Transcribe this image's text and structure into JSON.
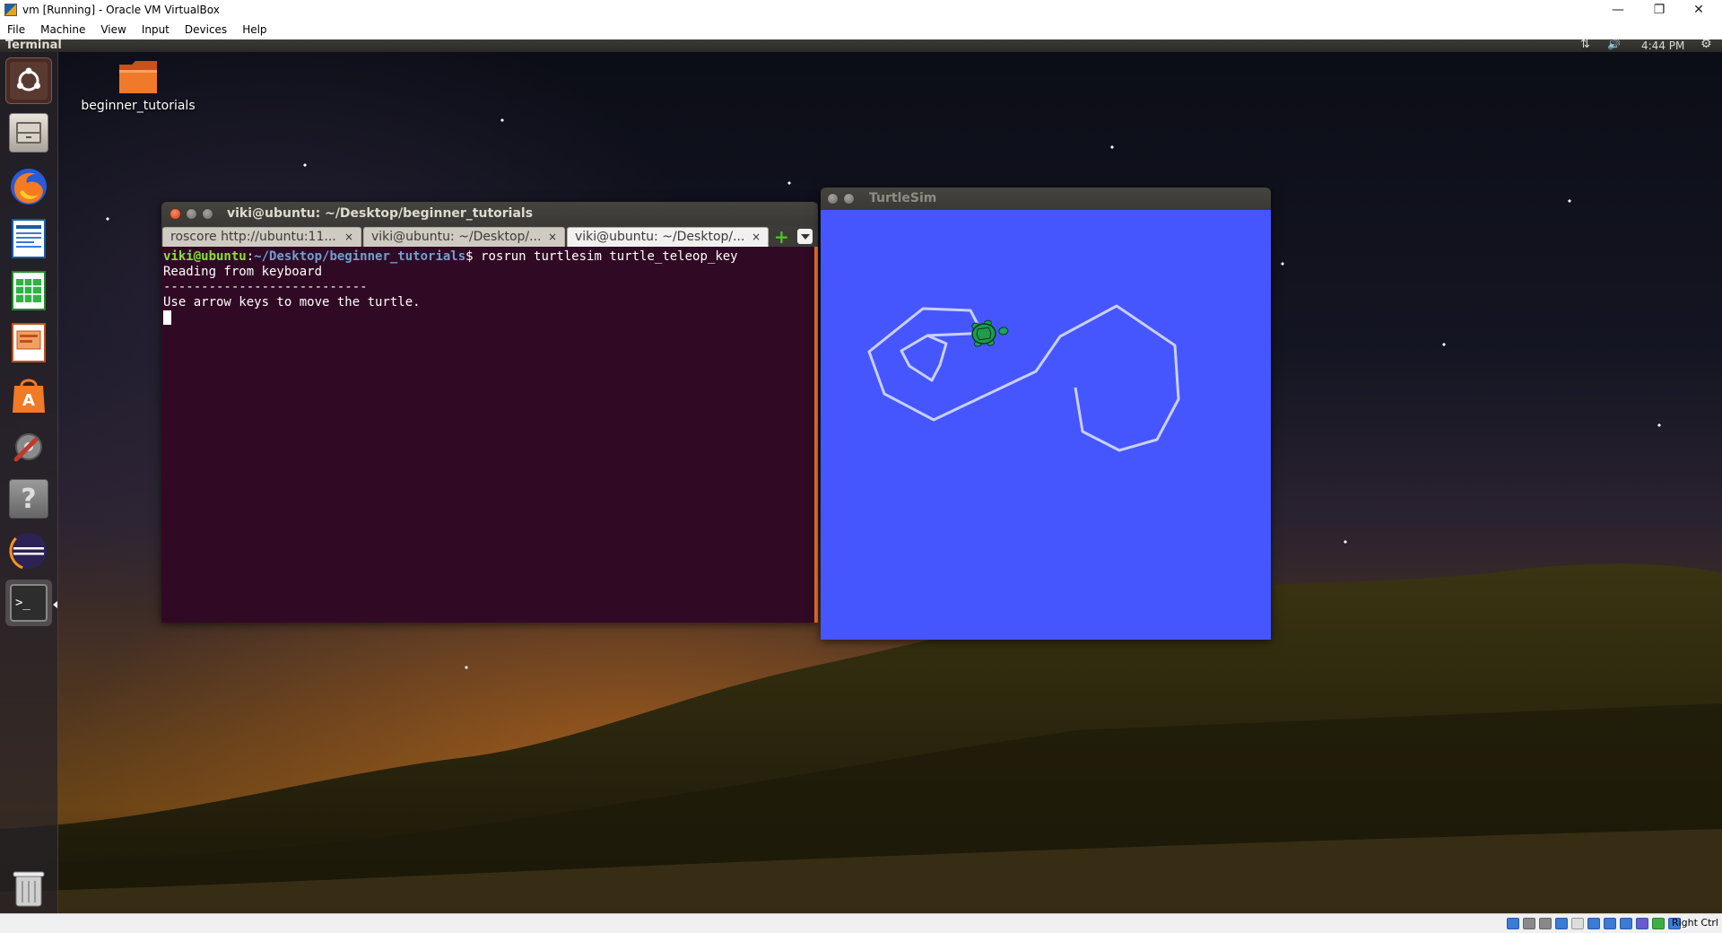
{
  "host_window": {
    "title": "vm [Running] - Oracle VM VirtualBox",
    "menu": [
      "File",
      "Machine",
      "View",
      "Input",
      "Devices",
      "Help"
    ],
    "status_host_key": "Right Ctrl"
  },
  "ubuntu_panel": {
    "app_name": "Terminal",
    "time": "4:44 PM"
  },
  "launcher": {
    "items": [
      "ubuntu-dash",
      "files",
      "firefox",
      "libreoffice-writer",
      "libreoffice-calc",
      "libreoffice-impress",
      "ubuntu-software",
      "system-settings",
      "help",
      "eclipse",
      "terminal",
      "trash"
    ]
  },
  "desktop": {
    "folder_label": "beginner_tutorials"
  },
  "terminal": {
    "title": "viki@ubuntu: ~/Desktop/beginner_tutorials",
    "tabs": [
      {
        "label": "roscore http://ubuntu:11...",
        "close": "×"
      },
      {
        "label": "viki@ubuntu: ~/Desktop/...",
        "close": "×"
      },
      {
        "label": "viki@ubuntu: ~/Desktop/...",
        "close": "×"
      }
    ],
    "prompt_user": "viki@ubuntu",
    "prompt_sep": ":",
    "prompt_path": "~/Desktop/beginner_tutorials",
    "prompt_cmd": "$ rosrun turtlesim turtle_teleop_key",
    "lines": [
      "Reading from keyboard",
      "---------------------------",
      "Use arrow keys to move the turtle."
    ]
  },
  "turtlesim": {
    "title": "TurtleSim",
    "background_color": "#4556ff",
    "trail_color": "#c9d0ff"
  }
}
